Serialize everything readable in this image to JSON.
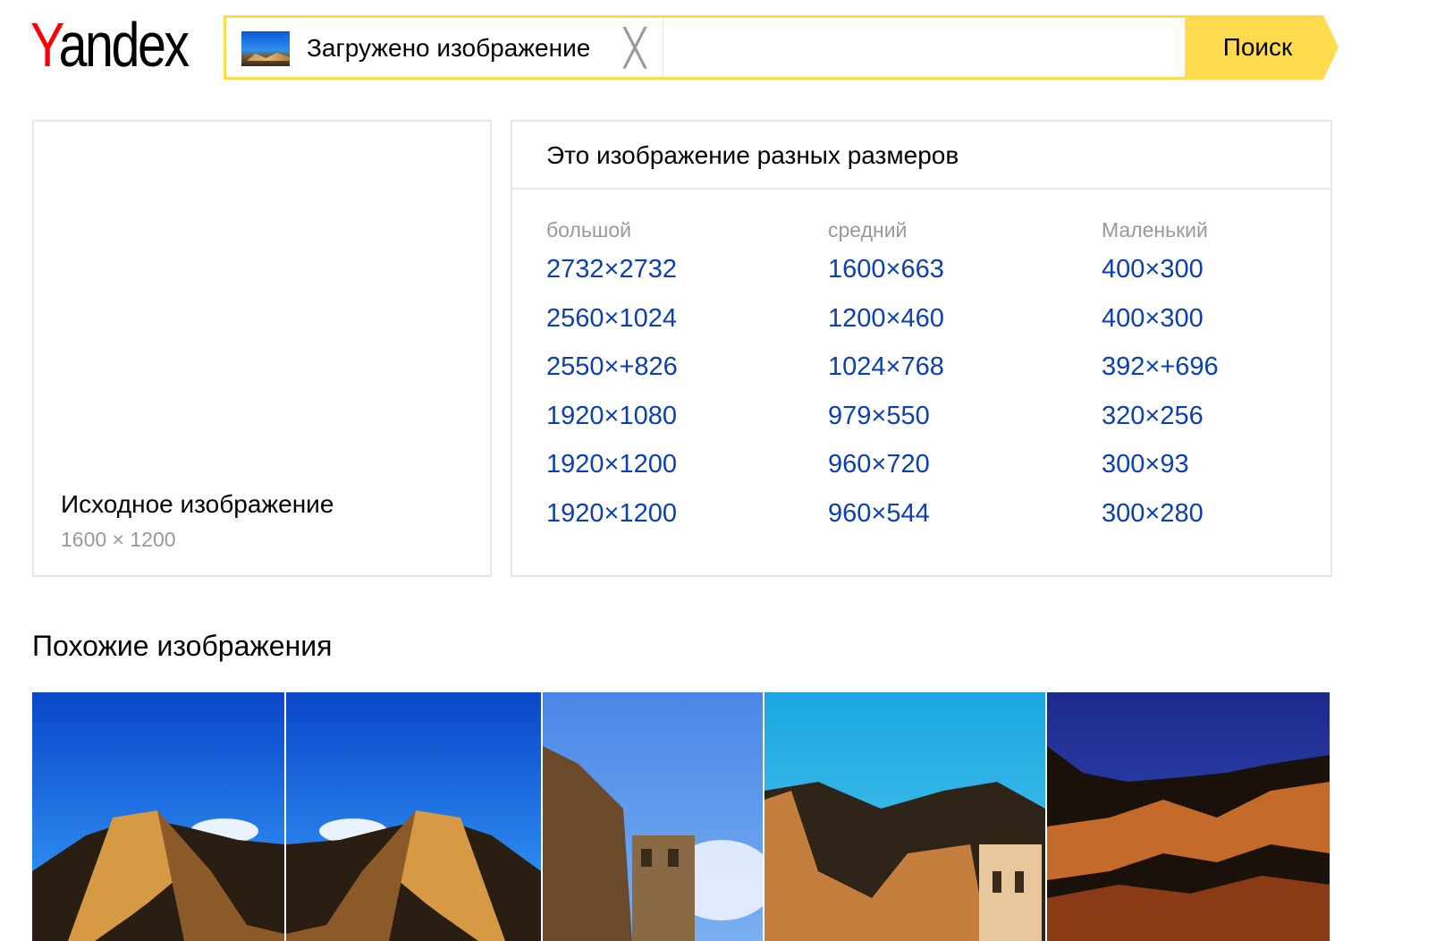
{
  "header": {
    "logo_first": "Y",
    "logo_rest": "andex",
    "chip_label": "Загружено изображение",
    "chip_close_glyph": "╳",
    "search_button": "Поиск"
  },
  "original": {
    "title": "Исходное изображение",
    "size": "1600 × 1200"
  },
  "sizes": {
    "title": "Это изображение разных размеров",
    "columns": [
      {
        "heading": "большой",
        "links": [
          "2732×2732",
          "2560×1024",
          "2550×+826",
          "1920×1080",
          "1920×1200",
          "1920×1200"
        ]
      },
      {
        "heading": "средний",
        "links": [
          "1600×663",
          "1200×460",
          "1024×768",
          "979×550",
          "960×720",
          "960×544"
        ]
      },
      {
        "heading": "Маленький",
        "links": [
          "400×300",
          "400×300",
          "392×+696",
          "320×256",
          "300×93",
          "300×280"
        ]
      }
    ]
  },
  "similar": {
    "title": "Похожие изображения"
  },
  "colors": {
    "accent": "#ffdb4d",
    "link": "#0a3fb8",
    "muted": "#999999",
    "border": "#e6e6e6"
  }
}
